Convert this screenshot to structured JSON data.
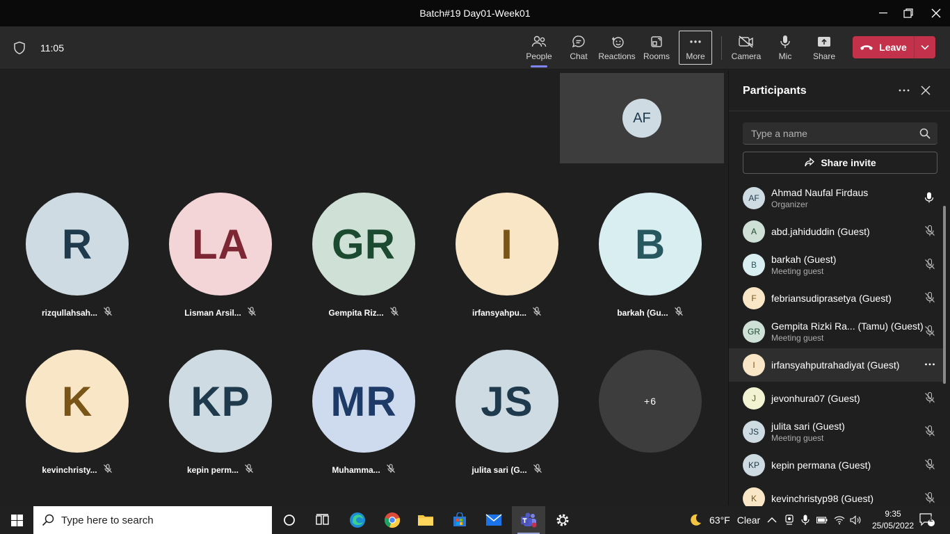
{
  "window": {
    "title": "Batch#19 Day01-Week01"
  },
  "meeting": {
    "elapsed": "11:05",
    "toolbar": {
      "people": "People",
      "chat": "Chat",
      "reactions": "Reactions",
      "rooms": "Rooms",
      "more": "More",
      "camera": "Camera",
      "mic": "Mic",
      "share": "Share",
      "leave": "Leave"
    },
    "active_tab": "People"
  },
  "self_tile": {
    "initials": "AF"
  },
  "grid": [
    {
      "initials": "R",
      "label": "rizqullahsah...",
      "bg": "#cfdbe2",
      "fg": "#1e3a4c",
      "muted": true
    },
    {
      "initials": "LA",
      "label": "Lisman Arsil...",
      "bg": "#f3d5d8",
      "fg": "#7c2733",
      "muted": true
    },
    {
      "initials": "GR",
      "label": "Gempita Riz...",
      "bg": "#cfe1d6",
      "fg": "#1c4a30",
      "muted": true
    },
    {
      "initials": "I",
      "label": "irfansyahpu...",
      "bg": "#f8e6c6",
      "fg": "#7a5518",
      "muted": true
    },
    {
      "initials": "B",
      "label": "barkah (Gu...",
      "bg": "#d9eef1",
      "fg": "#27575f",
      "muted": true
    },
    {
      "initials": "K",
      "label": "kevinchristy...",
      "bg": "#f8e6c6",
      "fg": "#7a5518",
      "muted": true
    },
    {
      "initials": "KP",
      "label": "kepin perm...",
      "bg": "#cfdbe2",
      "fg": "#1e3a4c",
      "muted": true
    },
    {
      "initials": "MR",
      "label": "Muhamma...",
      "bg": "#cedbef",
      "fg": "#1e3a66",
      "muted": true
    },
    {
      "initials": "JS",
      "label": "julita sari (G...",
      "bg": "#cfdbe2",
      "fg": "#1e3a4c",
      "muted": true
    }
  ],
  "overflow_tile": {
    "label": "+6"
  },
  "participants_panel": {
    "title": "Participants",
    "search_placeholder": "Type a name",
    "share_invite": "Share invite",
    "people": [
      {
        "initials": "AF",
        "name": "Ahmad Naufal Firdaus",
        "sub": "Organizer",
        "bg": "#cfdbe2",
        "fg": "#1e3a4c",
        "mic": "on"
      },
      {
        "initials": "A",
        "name": "abd.jahiduddin (Guest)",
        "sub": "",
        "bg": "#cfe1d6",
        "fg": "#1c4a30",
        "mic": "off"
      },
      {
        "initials": "B",
        "name": "barkah (Guest)",
        "sub": "Meeting guest",
        "bg": "#d9eef1",
        "fg": "#27575f",
        "mic": "off"
      },
      {
        "initials": "F",
        "name": "febriansudiprasetya (Guest)",
        "sub": "",
        "bg": "#f8e6c6",
        "fg": "#7a5518",
        "mic": "off"
      },
      {
        "initials": "GR",
        "name": "Gempita Rizki Ra... (Tamu) (Guest)",
        "sub": "Meeting guest",
        "bg": "#cfe1d6",
        "fg": "#1c4a30",
        "mic": "off"
      },
      {
        "initials": "I",
        "name": "irfansyahputrahadiyat (Guest)",
        "sub": "",
        "bg": "#f8e6c6",
        "fg": "#7a5518",
        "mic": "more"
      },
      {
        "initials": "J",
        "name": "jevonhura07 (Guest)",
        "sub": "",
        "bg": "#f1f3d2",
        "fg": "#5b5f1b",
        "mic": "off"
      },
      {
        "initials": "JS",
        "name": "julita sari (Guest)",
        "sub": "Meeting guest",
        "bg": "#cfdbe2",
        "fg": "#1e3a4c",
        "mic": "off"
      },
      {
        "initials": "KP",
        "name": "kepin permana (Guest)",
        "sub": "",
        "bg": "#cfdbe2",
        "fg": "#1e3a4c",
        "mic": "off"
      },
      {
        "initials": "K",
        "name": "kevinchristyp98 (Guest)",
        "sub": "",
        "bg": "#f8e6c6",
        "fg": "#7a5518",
        "mic": "off"
      }
    ]
  },
  "taskbar": {
    "search_placeholder": "Type here to search",
    "weather_temp": "63°F",
    "weather_desc": "Clear",
    "time": "9:35",
    "date": "25/05/2022",
    "notifications": "2"
  },
  "colors": {
    "accent": "#7f85f5",
    "leave": "#c4314b",
    "panel_bg": "#1f1f1f",
    "toolbar_bg": "#292929"
  }
}
